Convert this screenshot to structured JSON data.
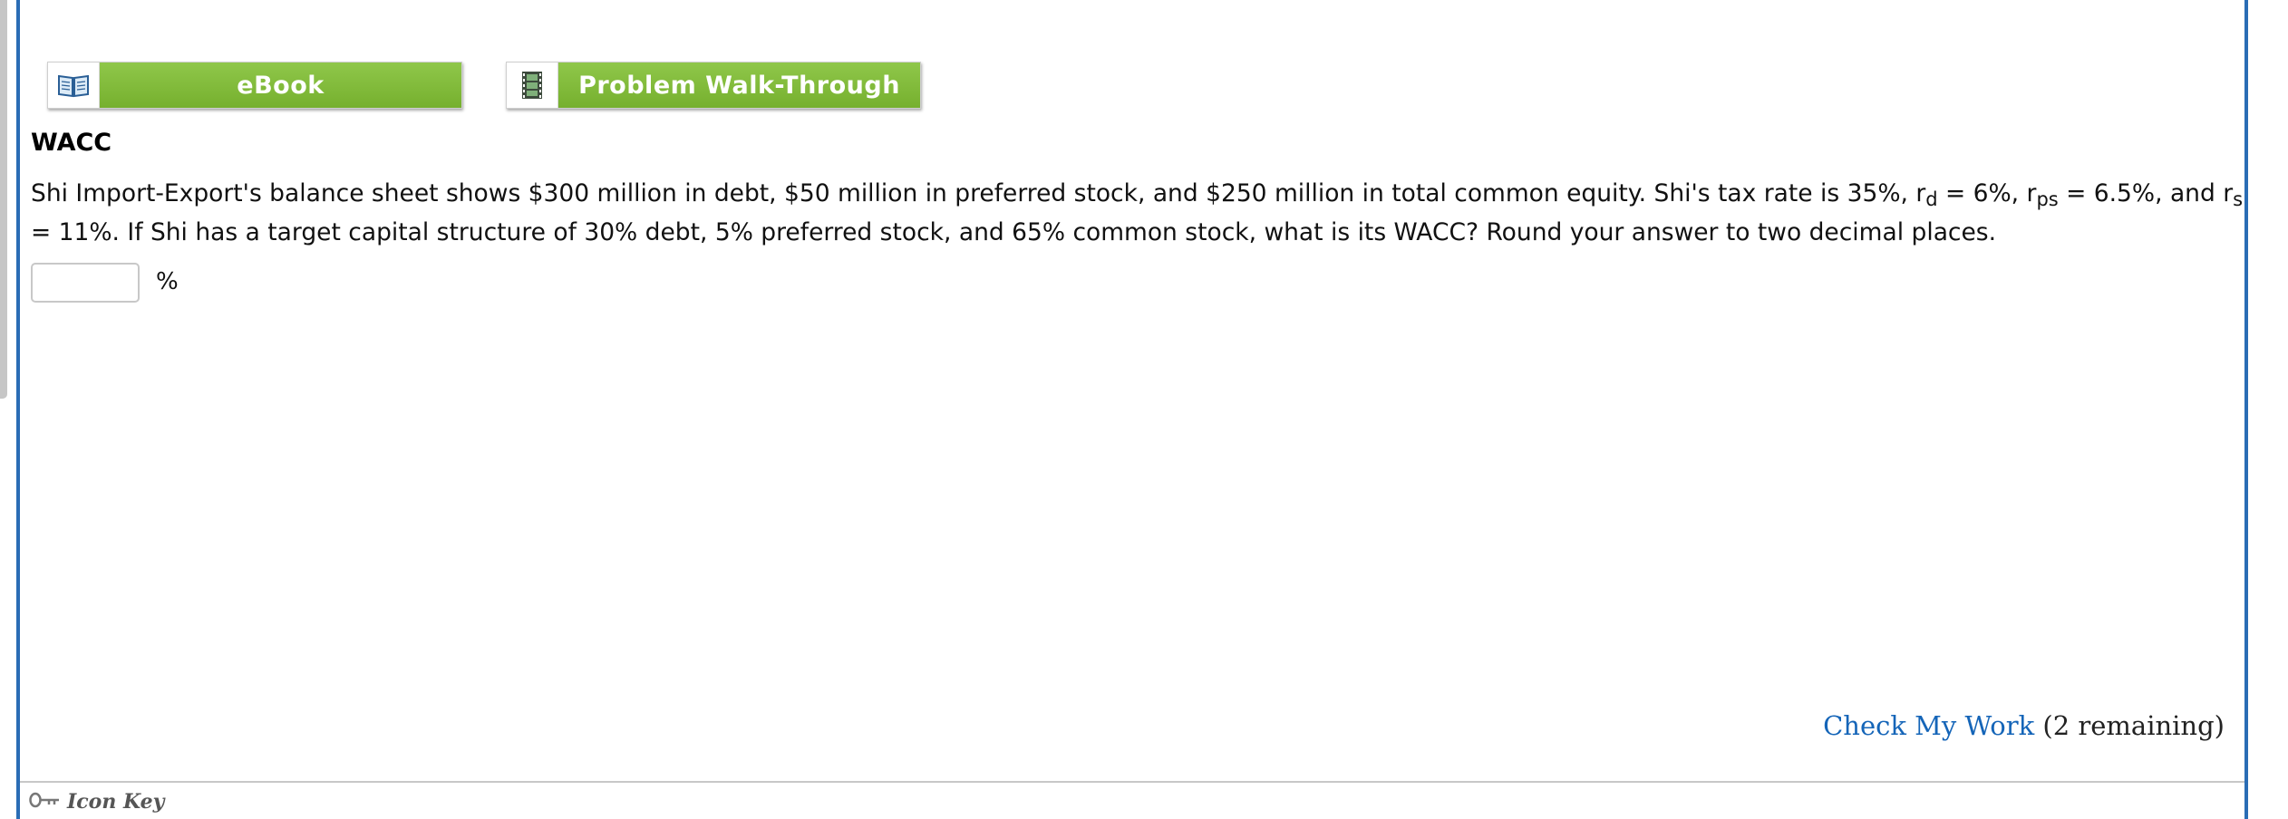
{
  "toolbar": {
    "ebook_label": "eBook",
    "walkthrough_label": "Problem Walk-Through"
  },
  "problem": {
    "title": "WACC",
    "text_part1": "Shi Import-Export's balance sheet shows $300 million in debt, $50 million in preferred stock, and $250 million in total common equity. Shi's tax rate is 35%, r",
    "sub_d": "d",
    "text_part2": " = 6%, r",
    "sub_ps": "ps",
    "text_part3": " = 6.5%, and r",
    "sub_s": "s",
    "text_part4": " = 11%. If Shi has a target capital structure of 30% debt, 5% preferred stock, and 65% common stock, what is its WACC? Round your answer to two decimal places.",
    "answer_value": "",
    "unit": "%"
  },
  "footer": {
    "check_label": "Check My Work",
    "remaining": "(2 remaining)",
    "icon_key_label": "Icon Key"
  },
  "colors": {
    "panel_border": "#2a6db5",
    "button_green": "#7fb83a",
    "link_blue": "#1565b8"
  },
  "icons": {
    "ebook": "open-book-icon",
    "walkthrough": "film-strip-icon",
    "icon_key": "key-icon"
  }
}
